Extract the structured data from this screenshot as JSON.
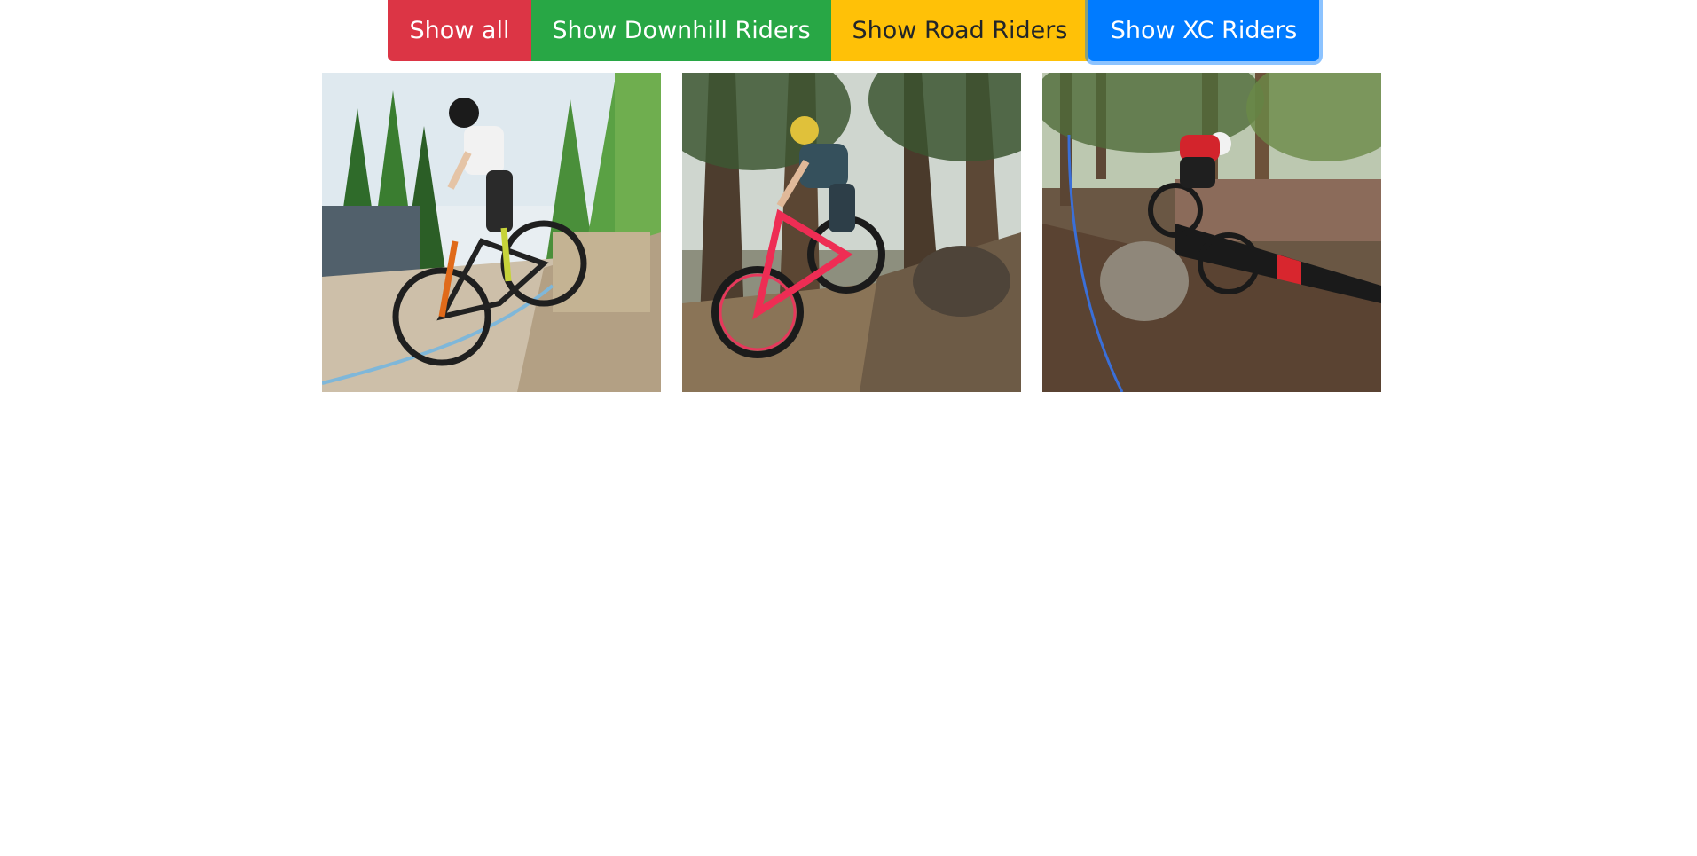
{
  "filters": {
    "buttons": [
      {
        "label": "Show all",
        "color": "#dc3545",
        "text_color": "#ffffff"
      },
      {
        "label": "Show Downhill Riders",
        "color": "#28a745",
        "text_color": "#ffffff"
      },
      {
        "label": "Show Road Riders",
        "color": "#ffc107",
        "text_color": "#212529"
      },
      {
        "label": "Show XC Riders",
        "color": "#007bff",
        "text_color": "#ffffff"
      }
    ],
    "focused": "Show XC Riders"
  },
  "gallery": {
    "items": [
      {
        "subject": "xc-rider-rocky-descent"
      },
      {
        "subject": "xc-rider-forest-jump"
      },
      {
        "subject": "xc-rider-banner-corner"
      }
    ]
  }
}
